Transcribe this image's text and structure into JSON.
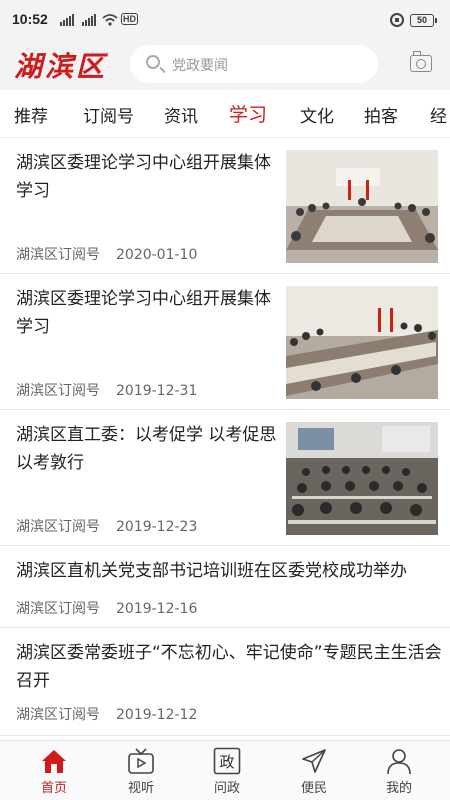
{
  "status_bar": {
    "time": "10:52",
    "battery": "50"
  },
  "header": {
    "logo": "湖滨区",
    "search_placeholder": "党政要闻"
  },
  "tabs": [
    {
      "label": "推荐"
    },
    {
      "label": "订阅号"
    },
    {
      "label": "资讯"
    },
    {
      "label": "学习"
    },
    {
      "label": "文化"
    },
    {
      "label": "拍客"
    },
    {
      "label": "经"
    }
  ],
  "active_tab": "学习",
  "articles": [
    {
      "title": "湖滨区委理论学习中心组开展集体学习",
      "source": "湖滨区订阅号",
      "date": "2020-01-10",
      "has_image": true
    },
    {
      "title": "湖滨区委理论学习中心组开展集体学习",
      "source": "湖滨区订阅号",
      "date": "2019-12-31",
      "has_image": true
    },
    {
      "title": "湖滨区直工委：以考促学 以考促思 以考敦行",
      "source": "湖滨区订阅号",
      "date": "2019-12-23",
      "has_image": true
    },
    {
      "title": "湖滨区直机关党支部书记培训班在区委党校成功举办",
      "source": "湖滨区订阅号",
      "date": "2019-12-16",
      "has_image": false
    },
    {
      "title": "湖滨区委常委班子“不忘初心、牢记使命”专题民主生活会召开",
      "source": "湖滨区订阅号",
      "date": "2019-12-12",
      "has_image": false
    }
  ],
  "bottom_nav": [
    {
      "label": "首页",
      "icon": "home-icon",
      "active": true
    },
    {
      "label": "视听",
      "icon": "tv-icon",
      "active": false
    },
    {
      "label": "问政",
      "icon": "zheng-icon",
      "icon_text": "政",
      "active": false
    },
    {
      "label": "便民",
      "icon": "send-icon",
      "active": false
    },
    {
      "label": "我的",
      "icon": "user-icon",
      "active": false
    }
  ],
  "colors": {
    "accent": "#d11a1a",
    "header_bg": "#f3f3f3"
  }
}
